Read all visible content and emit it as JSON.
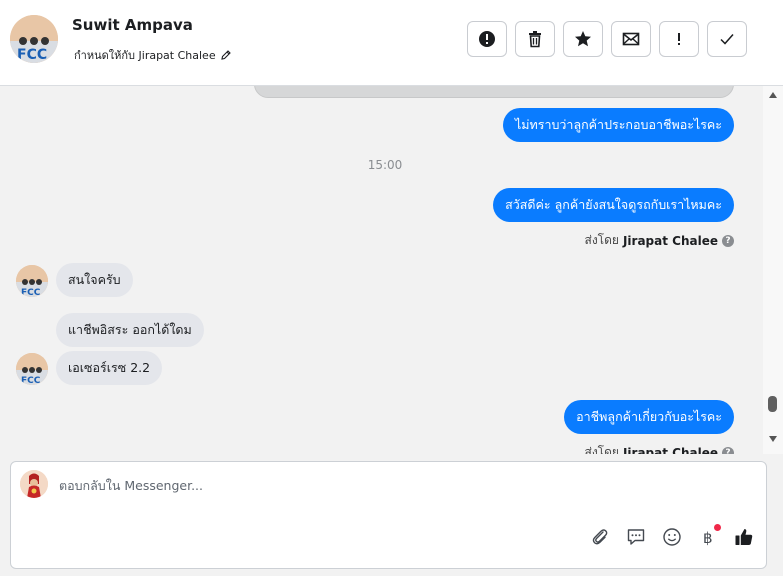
{
  "header": {
    "contact_name": "Suwit Ampava",
    "assigned_to": "กำหนดให้กับ Jirapat Chalee"
  },
  "messages": {
    "out1": "ไม่ทราบว่าลูกค้าประกอบอาชีพอะไรคะ",
    "time": "15:00",
    "out2": "สวัสดีค่ะ ลูกค้ายังสนใจดูรถกับเราไหมคะ",
    "sent_by_prefix": "ส่งโดย",
    "sent_by_name": "Jirapat Chalee",
    "in1": "สนใจครับ",
    "in2": "แาชีพอิสระ ออกได้ใดม",
    "in3": "เอเซอร์เรซ 2.2",
    "out3": "อาชีพลูกค้าเกี่ยวกับอะไรคะ"
  },
  "composer": {
    "placeholder": "ตอบกลับใน Messenger..."
  },
  "icons": {
    "actions": [
      "alert-circle-icon",
      "trash-icon",
      "star-icon",
      "envelope-icon",
      "exclamation-icon",
      "check-icon"
    ],
    "tools": [
      "paperclip-icon",
      "chat-icon",
      "smiley-icon",
      "baht-icon",
      "thumbs-up-icon"
    ]
  },
  "colors": {
    "outgoing_bubble": "#0a7cff",
    "incoming_bubble": "#e4e6eb",
    "notification_dot": "#f02849"
  }
}
